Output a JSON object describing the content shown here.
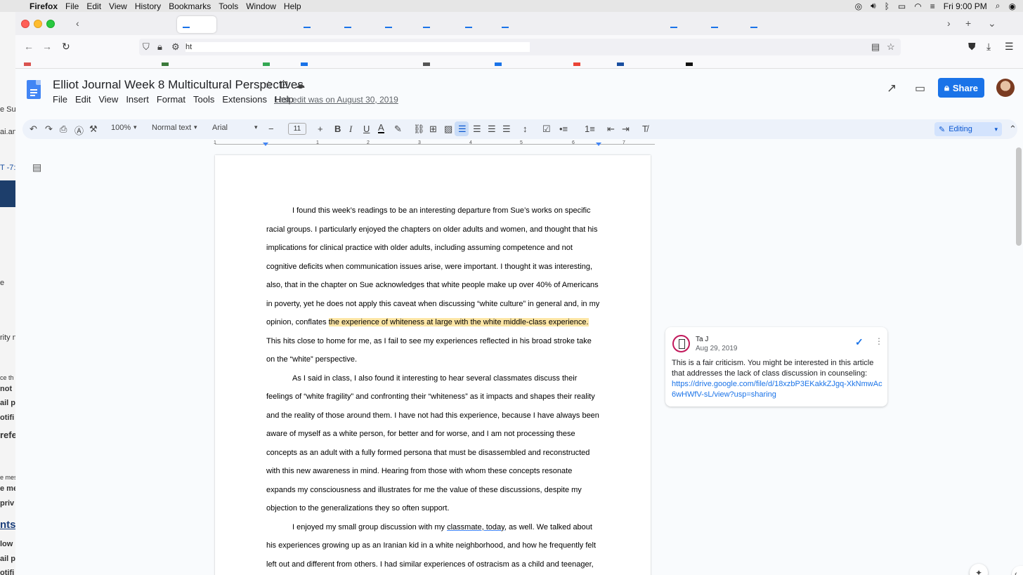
{
  "macos": {
    "apple": "",
    "app_name": "Firefox",
    "menu": [
      "File",
      "Edit",
      "View",
      "History",
      "Bookmarks",
      "Tools",
      "Window",
      "Help"
    ],
    "clock": "Fri 9:00 PM"
  },
  "background_app": {
    "fragments": [
      "e Sup",
      "ai.an",
      "T -7:",
      "e",
      "rity n",
      "ce th",
      "not",
      "ail p",
      "otifi",
      "refe",
      "e mes",
      "e me",
      "priv",
      "nts",
      "low",
      "ail p",
      "otifi"
    ]
  },
  "browser": {
    "url_value": "ht"
  },
  "doc": {
    "title": "Elliot Journal Week 8 Multicultural Perspectives",
    "menu": [
      "File",
      "Edit",
      "View",
      "Insert",
      "Format",
      "Tools",
      "Extensions",
      "Help"
    ],
    "last_edit": "Last edit was on August 30, 2019",
    "share_label": "Share"
  },
  "toolbar": {
    "zoom": "100%",
    "style": "Normal text",
    "font": "Arial",
    "font_size": "11",
    "mode": "Editing"
  },
  "ruler": [
    "1",
    "1",
    "2",
    "3",
    "4",
    "5",
    "6",
    "7"
  ],
  "body": {
    "p1_before": "I found this week’s readings to be an interesting departure from Sue’s works on specific racial groups.  I particularly enjoyed the chapters on older adults and women, and thought that his implications for clinical practice with older adults, including assuming competence and not cognitive deficits when communication issues arise, were important.  I thought it was interesting, also, that in the chapter on Sue acknowledges that white people make up over 40% of Americans in poverty, yet he does not apply this caveat when discussing “white culture” in general and, in my opinion, conflates ",
    "p1_highlight": "the experience of whiteness at large with the white middle-class experience. ",
    "p1_after": " This hits close to home for me, as I fail to see my experiences reflected in his broad stroke take on the “white” perspective.",
    "p2": "As I said in class, I also found it interesting to hear several classmates discuss their feelings of “white fragility” and confronting their “whiteness” as it impacts and shapes their reality and the reality of those around them.  I have not had this experience, because I have always been aware of myself as a white person, for better and for worse, and I am not processing these concepts as an adult with a fully formed persona that must be disassembled and reconstructed with this new awareness in mind.  Hearing from those with whom these concepts resonate expands my consciousness and illustrates for me the value of these discussions, despite my objection to the generalizations they so often support.",
    "p3_before": "I enjoyed my small group discussion with my ",
    "p3_spell": "classmate, today",
    "p3_after": ", as well.  We talked about his experiences growing up as an Iranian kid in a white neighborhood, and how he frequently felt left out and different from others.  I had similar experiences of ostracism as a child and teenager, and we both felt that we had been hurt by these experiences but that they also helped"
  },
  "comment": {
    "author": "Ta     J",
    "date": "Aug 29, 2019",
    "text": "This is a fair criticism. You might be interested in this article that addresses the lack of class discussion in counseling:",
    "link": "https://drive.google.com/file/d/18xzbP3EKakkZJgq-XkNmwAc6wHWfV-sL/view?usp=sharing"
  },
  "colors": {
    "accent": "#1a73e8",
    "highlight": "#fde6a6",
    "toolbar_bg": "#edf2fa"
  }
}
